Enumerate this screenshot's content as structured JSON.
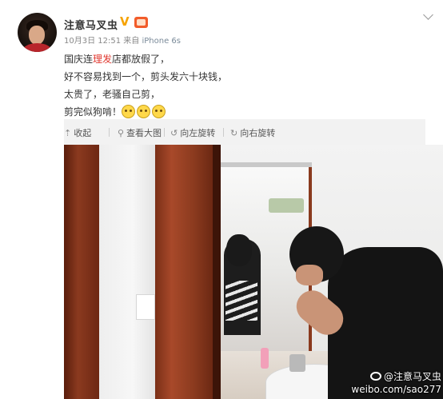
{
  "post": {
    "username": "注意马叉虫",
    "verified_badge": "V",
    "timestamp": "10月3日 12:51",
    "source_prefix": "来自",
    "source": "iPhone 6s",
    "content": {
      "line1_pre": "国庆连",
      "line1_highlight": "理发",
      "line1_post": "店都放假了，",
      "line2": "好不容易找到一个，剪头发六十块钱，",
      "line3": "太贵了，老骚自己剪，",
      "line4": "剪完似狗啃！"
    },
    "emoji_count": 3
  },
  "toolbar": {
    "collapse": "收起",
    "view_large": "查看大图",
    "rotate_left": "向左旋转",
    "rotate_right": "向右旋转"
  },
  "watermark": {
    "handle": "@注意马叉虫",
    "url": "weibo.com/sao277"
  },
  "icons": {
    "avatar": "user-avatar",
    "verified": "verified-v-icon",
    "member": "member-crown-icon",
    "menu": "chevron-down-icon",
    "collapse": "arrow-up-icon",
    "view_large": "magnifier-icon",
    "rotate_left": "rotate-left-icon",
    "rotate_right": "rotate-right-icon",
    "emoji": "cat-face-emoji"
  },
  "colors": {
    "highlight": "#e0372e",
    "verified": "#f6a300",
    "toolbar_bg": "#f2f2f2"
  }
}
